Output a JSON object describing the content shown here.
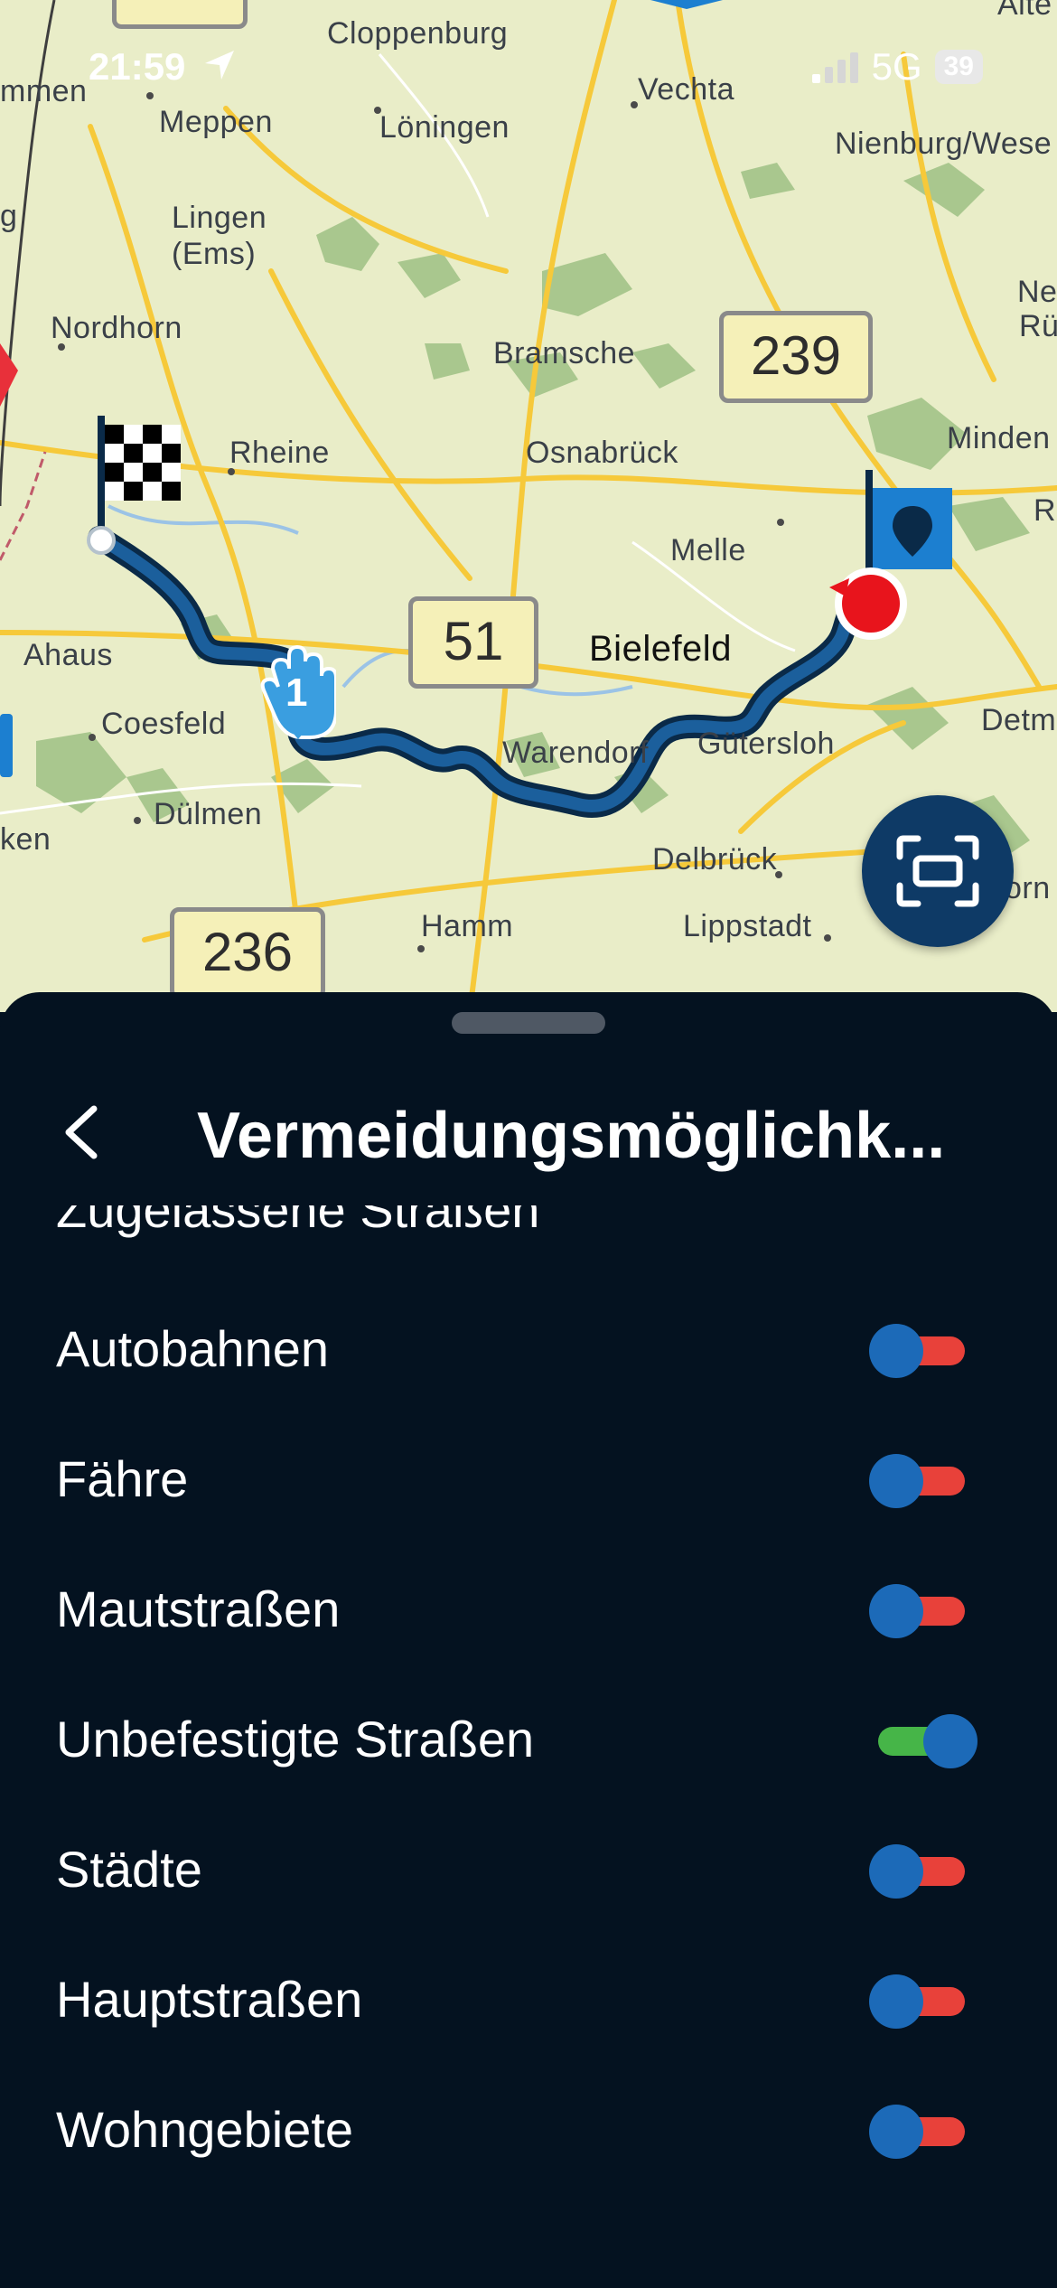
{
  "status_bar": {
    "time": "21:59",
    "network": "5G",
    "battery": "39"
  },
  "map": {
    "cities": [
      "Cloppenburg",
      "Vechta",
      "Meppen",
      "Löningen",
      "Nienburg/Wese",
      "Lingen",
      "(Ems)",
      "Nordhorn",
      "Bramsche",
      "Rheine",
      "Osnabrück",
      "Minden",
      "Melle",
      "Ahaus",
      "Bielefeld",
      "Coesfeld",
      "Warendorf",
      "Gütersloh",
      "Detmol",
      "Dülmen",
      "Delbrück",
      "Hamm",
      "Lippstadt",
      "mmen",
      "ken",
      "Ne",
      "Rü",
      "Ri",
      "orn",
      "Alte",
      "g"
    ],
    "road_shields": [
      "239",
      "51",
      "236"
    ],
    "waypoint_number": "1"
  },
  "sheet": {
    "title": "Vermeidungsmöglichk...",
    "section_header": "Zugelassene Straßen",
    "options": [
      {
        "label": "Autobahnen",
        "enabled": false
      },
      {
        "label": "Fähre",
        "enabled": false
      },
      {
        "label": "Mautstraßen",
        "enabled": false
      },
      {
        "label": "Unbefestigte Straßen",
        "enabled": true
      },
      {
        "label": "Städte",
        "enabled": false
      },
      {
        "label": "Hauptstraßen",
        "enabled": false
      },
      {
        "label": "Wohngebiete",
        "enabled": false
      }
    ]
  },
  "colors": {
    "accent": "#1c6ab8",
    "toggle_off": "#e8413a",
    "toggle_on": "#46b548",
    "sheet_bg": "#041220",
    "route": "#1b5f9c"
  }
}
